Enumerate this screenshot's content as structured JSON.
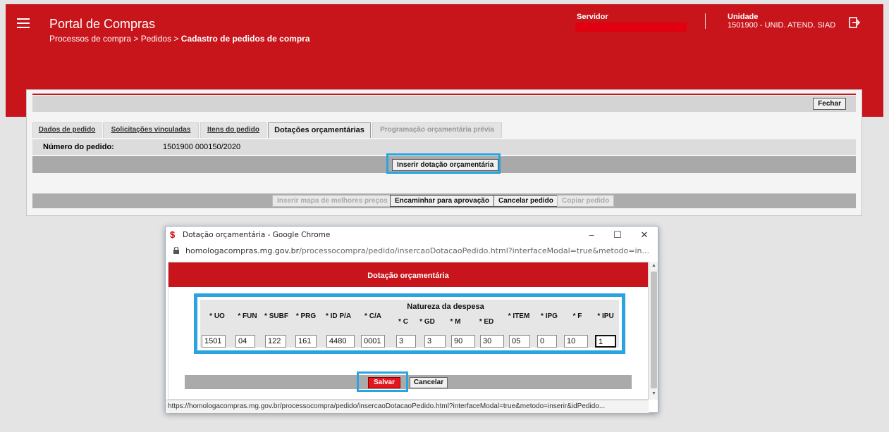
{
  "header": {
    "app_title": "Portal de Compras",
    "breadcrumb_path": "Processos de compra > Pedidos > ",
    "breadcrumb_current": "Cadastro de pedidos de compra",
    "server_label": "Servidor",
    "unit_label": "Unidade",
    "unit_value": "1501900 - UNID. ATEND. SIAD"
  },
  "panel": {
    "close_label": "Fechar",
    "tabs": [
      {
        "label": "Dados de pedido"
      },
      {
        "label": "Solicitações vinculadas"
      },
      {
        "label": "Itens do pedido"
      },
      {
        "label": "Dotações orçamentárias"
      },
      {
        "label": "Programação orçamentária prévia"
      }
    ],
    "order_number_label": "Número do pedido:",
    "order_number_value": "1501900 000150/2020",
    "insert_dotacao_label": "Inserir dotação orçamentária",
    "bottom_actions": {
      "map": "Inserir mapa de melhores preços",
      "forward": "Encaminhar para aprovação",
      "cancel": "Cancelar pedido",
      "copy": "Copiar pedido"
    }
  },
  "popup": {
    "window_title": "Dotação orçamentária - Google Chrome",
    "url_host": "homologacompras.mg.gov.br",
    "url_path": "/processocompra/pedido/insercaoDotacaoPedido.html?interfaceModal=true&metodo=in...",
    "modal_title": "Dotação orçamentária",
    "natureza_label": "Natureza da despesa",
    "columns": {
      "uo": "* UO",
      "fun": "* FUN",
      "subf": "* SUBF",
      "prg": "* PRG",
      "idpa": "* ID P/A",
      "ca": "* C/A",
      "c": "* C",
      "gd": "* GD",
      "m": "* M",
      "ed": "* ED",
      "item": "* ITEM",
      "ipg": "* IPG",
      "f": "* F",
      "ipu": "* IPU"
    },
    "values": {
      "uo": "1501",
      "fun": "04",
      "subf": "122",
      "prg": "161",
      "idpa": "4480",
      "ca": "0001",
      "c": "3",
      "gd": "3",
      "m": "90",
      "ed": "30",
      "item": "05",
      "ipg": "0",
      "f": "10",
      "ipu": "1"
    },
    "save_label": "Salvar",
    "cancel_label": "Cancelar",
    "status_url": "https://homologacompras.mg.gov.br/processocompra/pedido/insercaoDotacaoPedido.html?interfaceModal=true&metodo=inserir&idPedido..."
  },
  "colors": {
    "brand_red": "#c8151b",
    "highlight_blue": "#2aa4e0"
  }
}
